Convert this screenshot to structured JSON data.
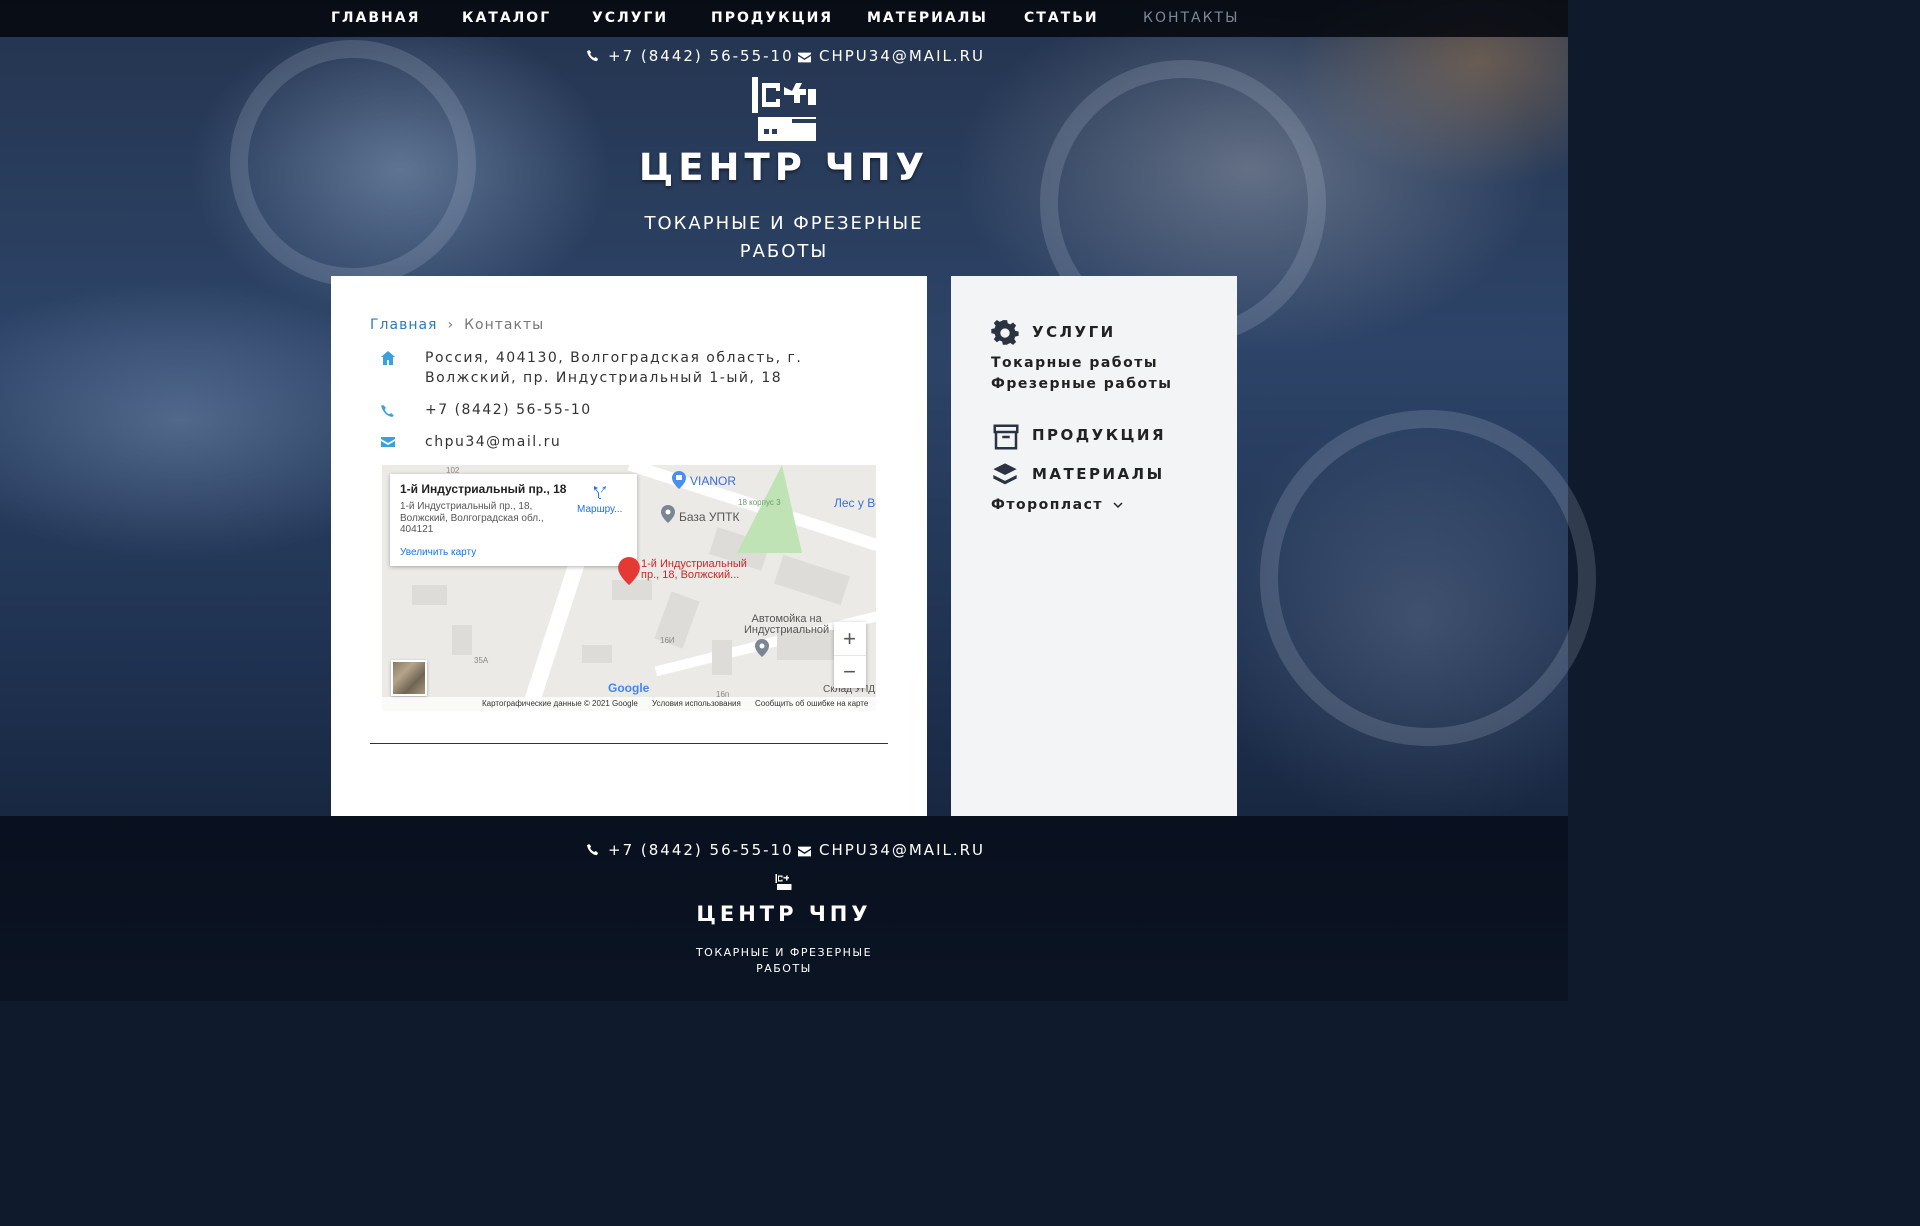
{
  "nav": {
    "items": [
      {
        "label": "ГЛАВНАЯ"
      },
      {
        "label": "КАТАЛОГ"
      },
      {
        "label": "УСЛУГИ"
      },
      {
        "label": "ПРОДУКЦИЯ"
      },
      {
        "label": "МАТЕРИАЛЫ"
      },
      {
        "label": "СТАТЬИ"
      },
      {
        "label": "КОНТАКТЫ"
      }
    ]
  },
  "header": {
    "phone": "+7 (8442) 56-55-10",
    "email": "CHPU34@MAIL.RU",
    "title": "ЦЕНТР ЧПУ",
    "subtitle_line1": "ТОКАРНЫЕ И ФРЕЗЕРНЫЕ",
    "subtitle_line2": "РАБОТЫ"
  },
  "breadcrumb": {
    "home": "Главная",
    "current": "Контакты"
  },
  "contacts": {
    "address": "Россия, 404130, Волгоградская область, г. Волжский, пр. Индустриальный 1-ый, 18",
    "phone": "+7 (8442) 56-55-10",
    "email": "chpu34@mail.ru"
  },
  "map": {
    "info_title": "1-й Индустриальный пр., 18",
    "info_address": "1-й Индустриальный пр., 18, Волжский, Волгоградская обл., 404121",
    "info_zoom": "Увеличить карту",
    "info_route": "Маршру...",
    "marker_label_1": "1-й Индустриальный",
    "marker_label_2": "пр., 18, Волжский...",
    "poi_vianor": "VIANOR",
    "poi_baza": "База УПТК",
    "poi_les": "Лес у Во",
    "poi_korpus": "18 корпус 3",
    "poi_carwash_1": "Автомойка на",
    "poi_carwash_2": "Индустриальной",
    "poi_sklad": "Склад УПД",
    "num_102": "102",
    "num_35a": "35А",
    "num_16i": "16И",
    "num_16p": "16п",
    "zoom_in": "+",
    "zoom_out": "−",
    "google": "Google",
    "footer_data": "Картографические данные © 2021 Google",
    "footer_terms": "Условия использования",
    "footer_report": "Сообщить об ошибке на карте"
  },
  "sidebar": {
    "services_title": "УСЛУГИ",
    "services": [
      "Токарные работы",
      "Фрезерные работы"
    ],
    "products_title": "ПРОДУКЦИЯ",
    "materials_title": "МАТЕРИАЛЫ",
    "materials_sub": "Фторопласт"
  },
  "footer": {
    "phone": "+7 (8442) 56-55-10",
    "email": "CHPU34@MAIL.RU",
    "title": "ЦЕНТР ЧПУ",
    "subtitle_line1": "ТОКАРНЫЕ И ФРЕЗЕРНЫЕ",
    "subtitle_line2": "РАБОТЫ"
  },
  "colors": {
    "accent": "#2a7bc4",
    "nav_bg": "#0a0e16",
    "sidebar_bg": "#f3f4f6",
    "icon_blue": "#3aa0e0"
  }
}
